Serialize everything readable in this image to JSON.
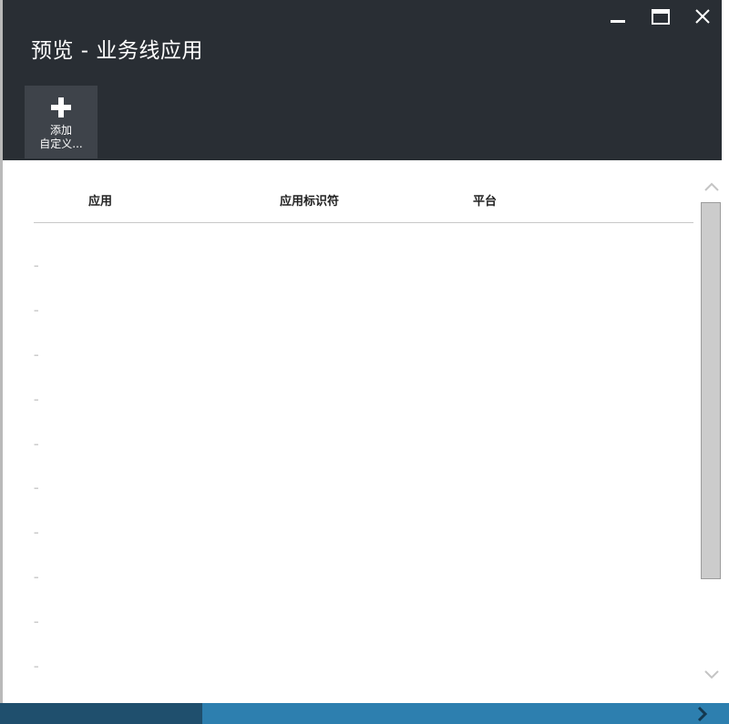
{
  "window": {
    "title": "预览 - 业务线应用",
    "controls": [
      "minimize-icon",
      "maximize-icon",
      "close-icon"
    ]
  },
  "commands": {
    "add_custom": {
      "icon": "plus-icon",
      "label_line1": "添加",
      "label_line2": "自定义..."
    }
  },
  "grid": {
    "columns": [
      "应用",
      "应用标识符",
      "平台"
    ],
    "rows": [
      {
        "marker": "–"
      },
      {
        "marker": "–"
      },
      {
        "marker": "–"
      },
      {
        "marker": "–"
      },
      {
        "marker": "–"
      },
      {
        "marker": "–"
      },
      {
        "marker": "–"
      },
      {
        "marker": "–"
      },
      {
        "marker": "–"
      },
      {
        "marker": "–"
      }
    ]
  },
  "scrollbar": {
    "up_icon": "chevron-up-icon",
    "down_icon": "chevron-down-icon"
  },
  "taskbar": {
    "arrow_icon": "chevron-right-icon"
  },
  "colors": {
    "header_bg": "#292e34",
    "command_bg": "#3e434a",
    "taskbar_bg": "#2d7faf",
    "taskbar_dark": "#1f4f6d"
  }
}
